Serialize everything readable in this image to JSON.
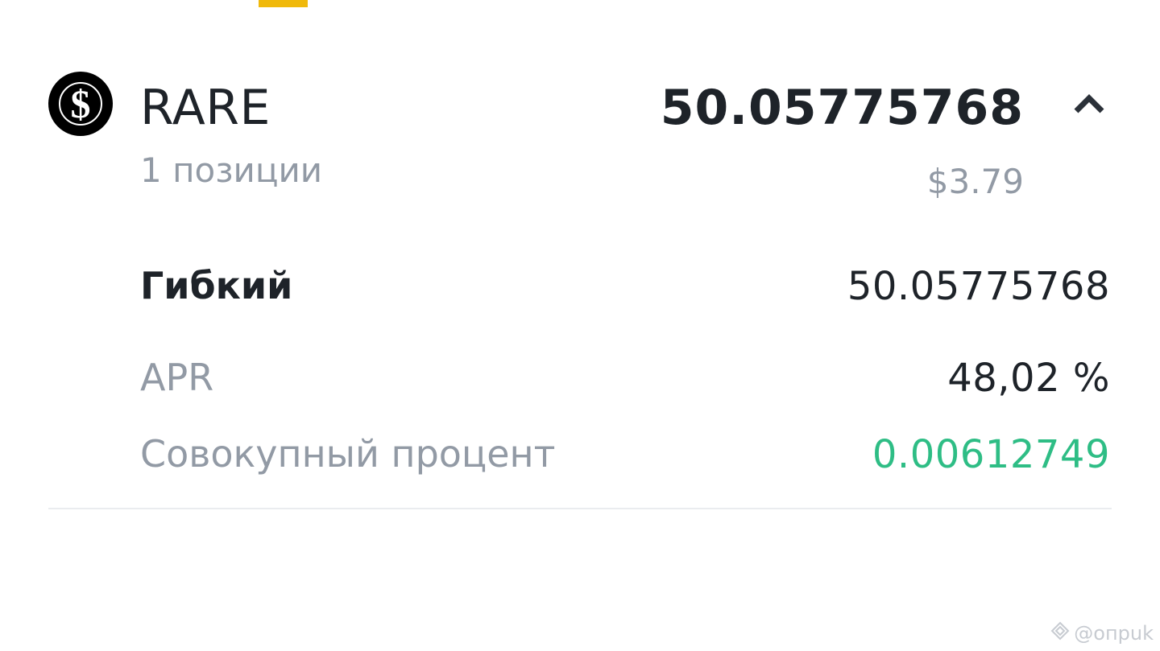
{
  "coin": {
    "symbol": "RARE",
    "positions_label": "1 позиции",
    "total_amount": "50.05775768",
    "usd_value": "$3.79",
    "logo_icon": "dollar-coin-icon",
    "logo_colors": {
      "circle": "#000000",
      "glyph": "#ffffff"
    },
    "expanded": true
  },
  "details": {
    "flexible_label": "Гибкий",
    "flexible_value": "50.05775768",
    "apr_label": "APR",
    "apr_value": "48,02 %",
    "cumulative_label": "Совокупный процент",
    "cumulative_value": "0.00612749"
  },
  "watermark": {
    "text": "@опрuk",
    "icon": "diamond-logo-icon"
  },
  "colors": {
    "accent_yellow": "#F0B90B",
    "text_primary": "#1E2329",
    "text_secondary": "#929AA5",
    "positive_green": "#2EBD85",
    "divider": "#EAECEF"
  }
}
